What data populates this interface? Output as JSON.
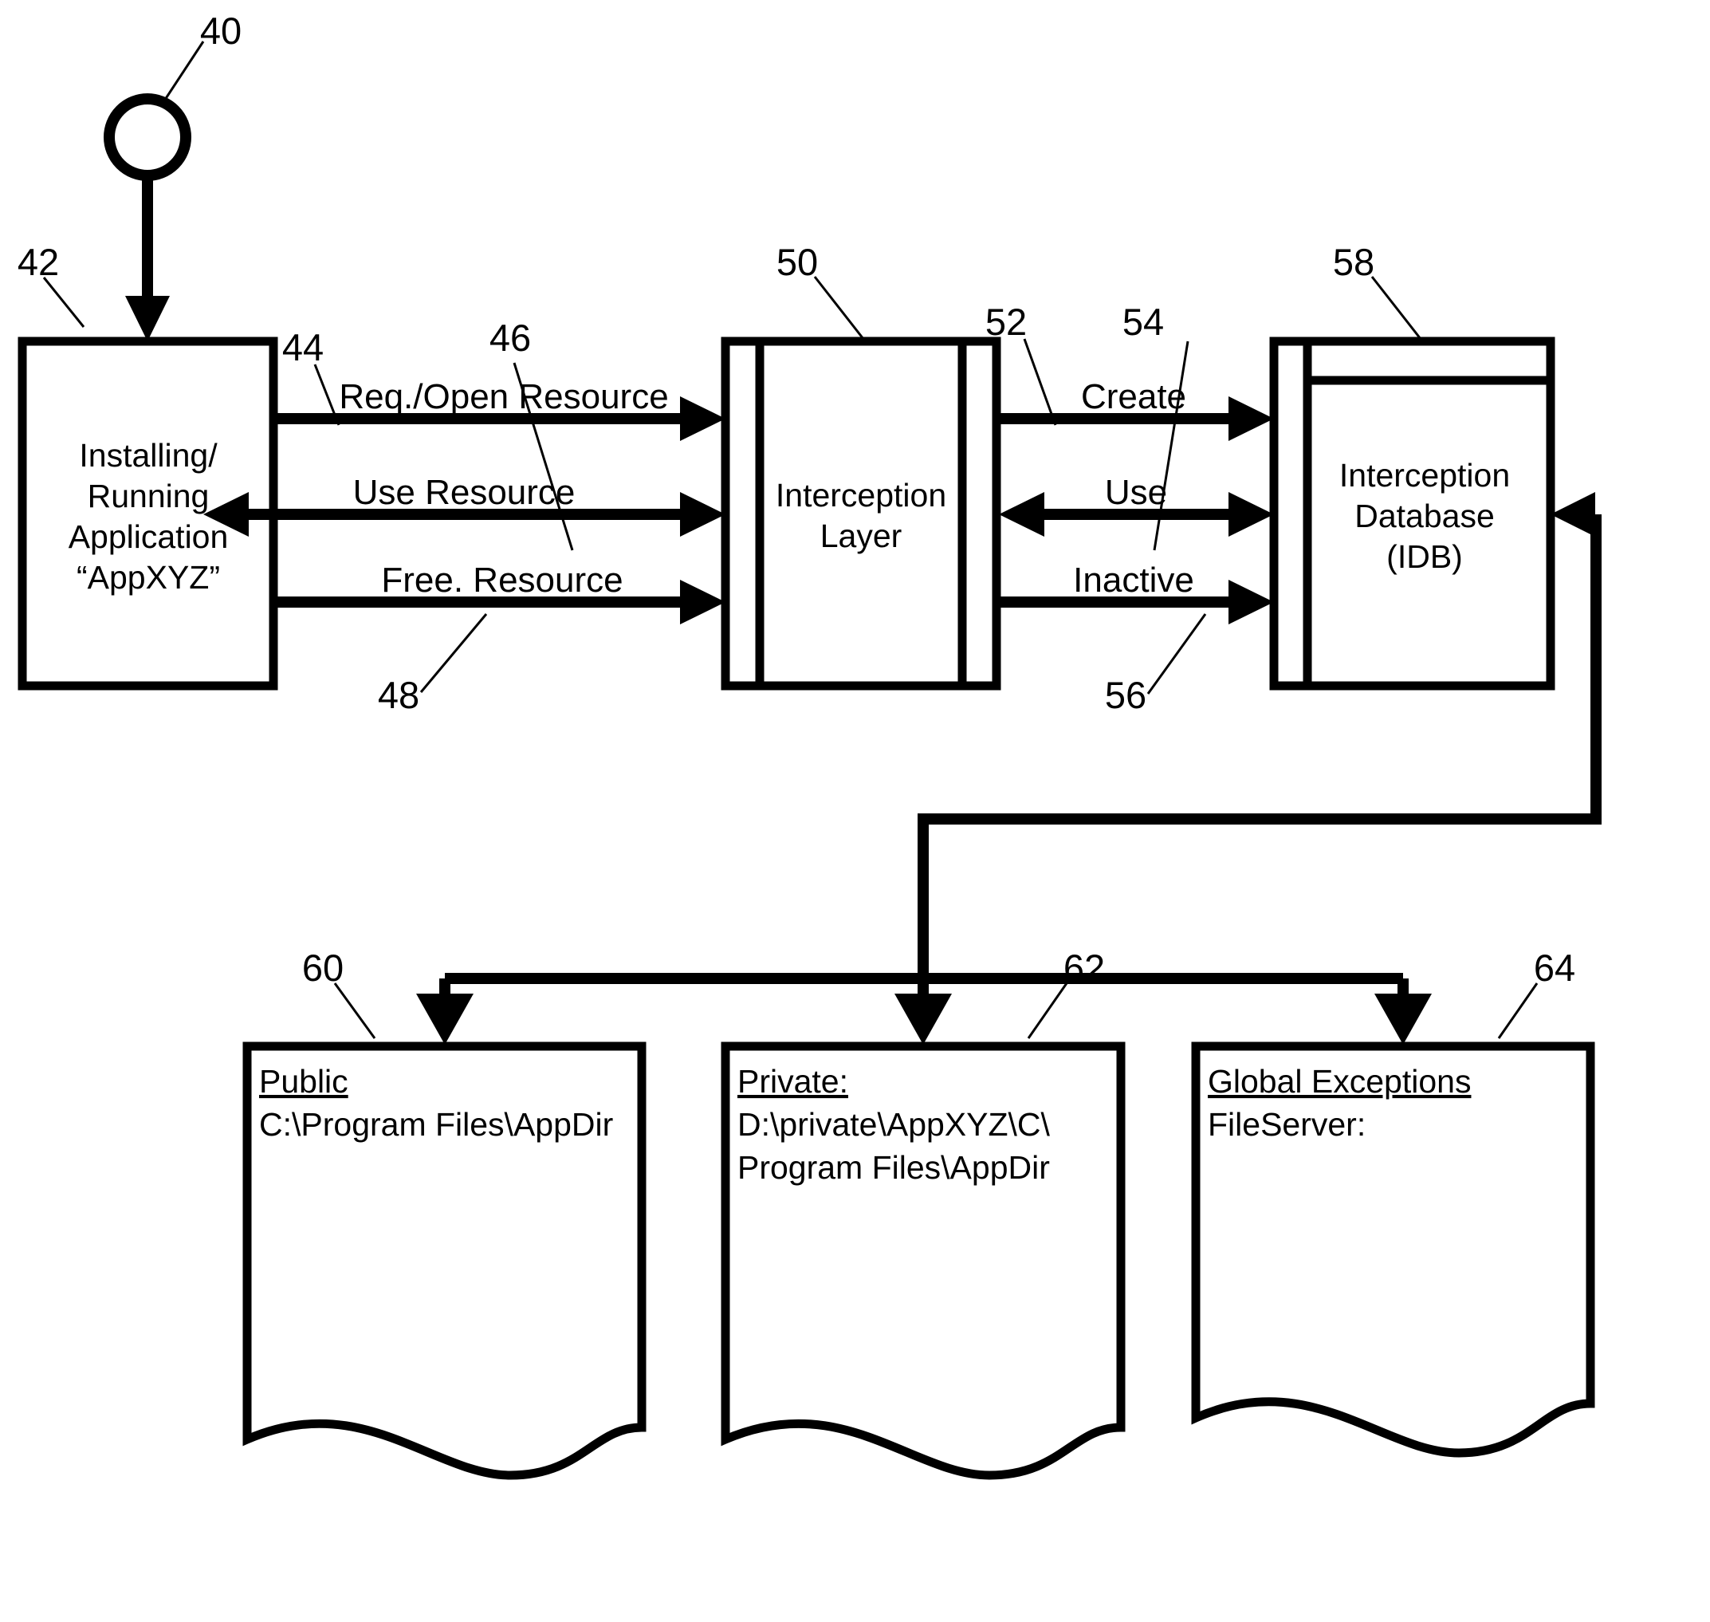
{
  "figure": {
    "title": "Resource interception and redirection block diagram",
    "stroke_color": "#000000",
    "background_color": "#ffffff"
  },
  "nodes": {
    "start": {
      "ref": "40",
      "shape": "circle"
    },
    "application": {
      "ref": "42",
      "lines": [
        "Installing/",
        "Running",
        "Application",
        "“AppXYZ”"
      ],
      "line1": "Installing/",
      "line2": "Running",
      "line3": "Application",
      "line4": "“AppXYZ”"
    },
    "interception_layer": {
      "ref": "50",
      "line1": "Interception",
      "line2": "Layer"
    },
    "interception_database": {
      "ref": "58",
      "line1": "Interception",
      "line2": "Database",
      "line3": "(IDB)"
    }
  },
  "flows": {
    "req_open_resource": {
      "ref": "44",
      "label": "Req./Open Resource",
      "direction": "right"
    },
    "use_resource": {
      "ref": "46",
      "label": "Use Resource",
      "direction": "both"
    },
    "free_resource": {
      "ref": "48",
      "label": "Free. Resource",
      "direction": "right"
    },
    "create": {
      "ref": "52",
      "label": "Create",
      "direction": "right"
    },
    "use": {
      "ref": "54",
      "label": "Use",
      "direction": "both"
    },
    "inactive": {
      "ref": "56",
      "label": "Inactive",
      "direction": "right"
    }
  },
  "documents": [
    {
      "ref": "60",
      "title": "Public",
      "lines": [
        "C:\\Program Files\\AppDir"
      ],
      "line1": "C:\\Program Files\\AppDir",
      "line2": ""
    },
    {
      "ref": "62",
      "title": "Private:",
      "lines": [
        "D:\\private\\AppXYZ\\C\\",
        "Program Files\\AppDir"
      ],
      "line1": "D:\\private\\AppXYZ\\C\\",
      "line2": "Program Files\\AppDir"
    },
    {
      "ref": "64",
      "title": "Global Exceptions",
      "lines": [
        "FileServer:"
      ],
      "line1": "FileServer:",
      "line2": ""
    }
  ]
}
